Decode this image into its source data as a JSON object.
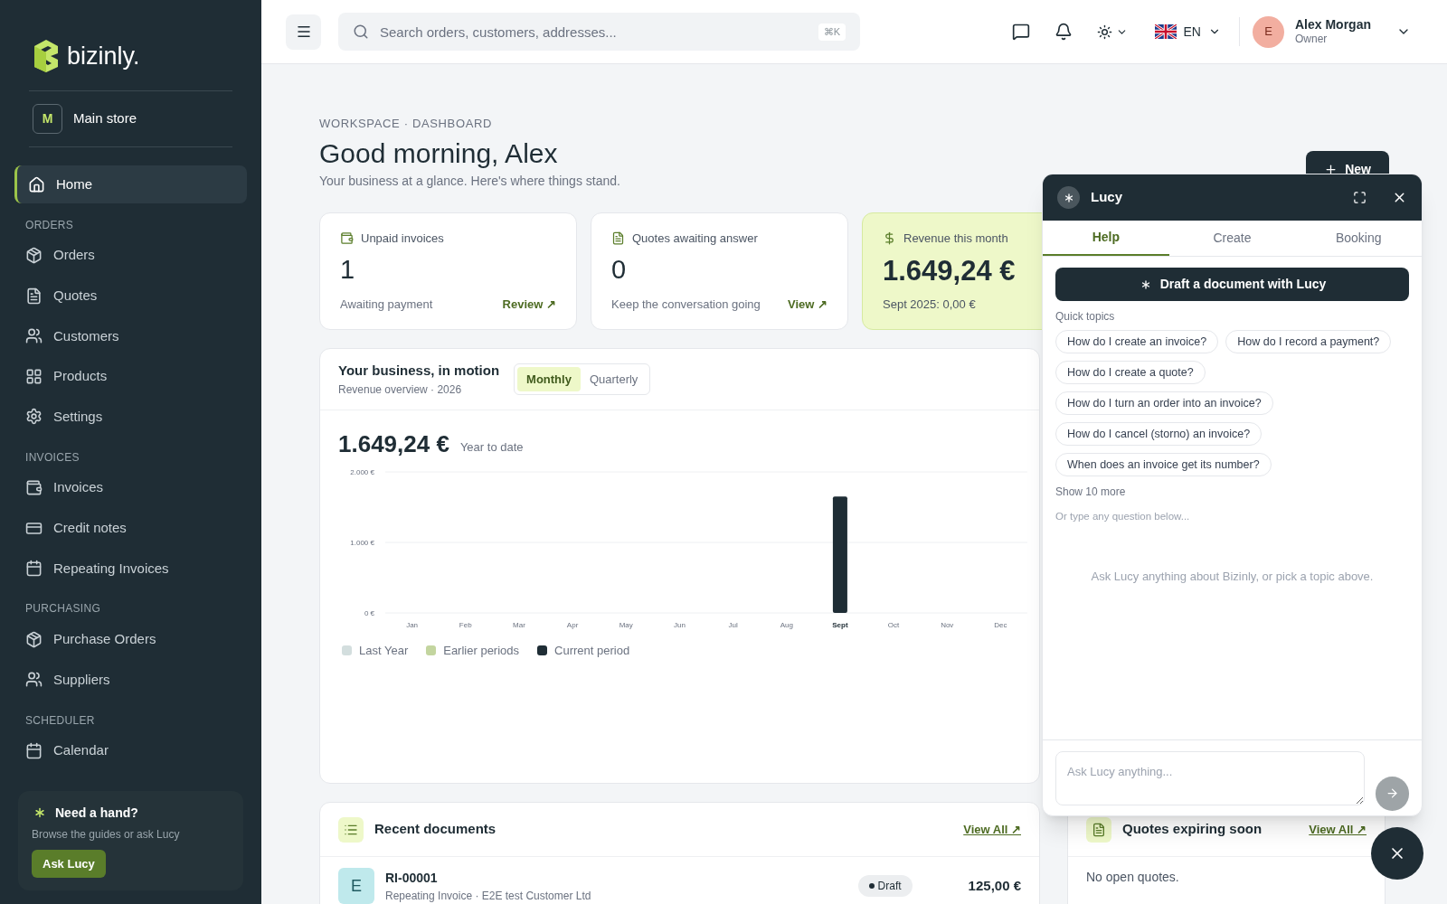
{
  "brand": {
    "name": "bizinly."
  },
  "store": {
    "initial": "M",
    "name": "Main store"
  },
  "sidebar": {
    "sections": [
      {
        "items": [
          {
            "label": "Home",
            "kind": "home",
            "selected": true
          }
        ]
      },
      {
        "title": "ORDERS",
        "items": [
          {
            "label": "Orders",
            "kind": "box",
            "selected": false
          },
          {
            "label": "Quotes",
            "kind": "file",
            "selected": false
          },
          {
            "label": "Customers",
            "kind": "users",
            "selected": false
          },
          {
            "label": "Products",
            "kind": "grid",
            "selected": false
          },
          {
            "label": "Settings",
            "kind": "gear",
            "selected": false
          }
        ]
      },
      {
        "title": "INVOICES",
        "items": [
          {
            "label": "Invoices",
            "kind": "wallet",
            "selected": false
          },
          {
            "label": "Credit notes",
            "kind": "card",
            "selected": false
          },
          {
            "label": "Repeating Invoices",
            "kind": "calendar",
            "selected": false
          }
        ]
      },
      {
        "title": "PURCHASING",
        "items": [
          {
            "label": "Purchase Orders",
            "kind": "box",
            "selected": false
          },
          {
            "label": "Suppliers",
            "kind": "users",
            "selected": false
          }
        ]
      },
      {
        "title": "SCHEDULER",
        "items": [
          {
            "label": "Calendar",
            "kind": "calendar",
            "selected": false
          }
        ]
      }
    ],
    "help": {
      "title": "Need a hand?",
      "text": "Browse the guides or ask Lucy",
      "button": "Ask Lucy"
    }
  },
  "topbar": {
    "search": {
      "placeholder": "Search orders, customers, addresses...",
      "shortcut": "⌘K"
    },
    "language": "EN",
    "user": {
      "initial": "E",
      "name": "Alex Morgan",
      "role": "Owner"
    }
  },
  "breadcrumb": "WORKSPACE · DASHBOARD",
  "greeting": "Good morning, Alex",
  "subtitle": "Your business at a glance. Here's where things stand.",
  "new_button": "New",
  "stats": [
    {
      "kind": "wallet",
      "label": "Unpaid invoices",
      "value": "1",
      "note": "Awaiting payment",
      "link": "Review ↗",
      "highlight": false
    },
    {
      "kind": "file",
      "label": "Quotes awaiting answer",
      "value": "0",
      "note": "Keep the conversation going",
      "link": "View ↗",
      "highlight": false
    },
    {
      "kind": "dollar",
      "label": "Revenue this month",
      "value": "1.649,24 €",
      "note": "Sept 2025: 0,00 €",
      "highlight": true
    }
  ],
  "overview": {
    "title": "Your business, in motion",
    "subtitle": "Revenue overview · 2026",
    "toggle": [
      {
        "label": "Monthly",
        "selected": true
      },
      {
        "label": "Quarterly",
        "selected": false
      }
    ],
    "total": "1.649,24 €",
    "total_label": "Year to date",
    "chart_data": {
      "type": "bar",
      "categories": [
        "Jan",
        "Feb",
        "Mar",
        "Apr",
        "May",
        "Jun",
        "Jul",
        "Aug",
        "Sept",
        "Oct",
        "Nov",
        "Dec"
      ],
      "series": [
        {
          "name": "Last Year",
          "color": "#d3dede",
          "values": [
            null,
            null,
            null,
            null,
            null,
            null,
            null,
            null,
            null,
            null,
            null,
            null
          ]
        },
        {
          "name": "Earlier periods",
          "color": "#c3d59f",
          "values": [
            null,
            null,
            null,
            null,
            null,
            null,
            null,
            null,
            null,
            null,
            null,
            null
          ]
        },
        {
          "name": "Current period",
          "color": "#1f2d35",
          "values": [
            null,
            null,
            null,
            null,
            null,
            null,
            null,
            null,
            1650,
            null,
            null,
            null
          ]
        }
      ],
      "ylim": [
        0,
        2000
      ],
      "yticks": [
        {
          "value": 0,
          "label": "0 €"
        },
        {
          "value": 1000,
          "label": "1.000 €"
        },
        {
          "value": 2000,
          "label": "2.000 €"
        }
      ]
    }
  },
  "recent": {
    "title": "Recent documents",
    "link": "View All ↗",
    "rows": [
      {
        "initial": "E",
        "number": "RI-00001",
        "detail": "Repeating Invoice · E2E test Customer Ltd",
        "status": "Draft",
        "amount": "125,00 €"
      }
    ]
  },
  "quotes_expiring": {
    "title": "Quotes expiring soon",
    "link": "View All ↗",
    "empty": "No open quotes."
  },
  "lucy": {
    "title": "Lucy",
    "tabs": [
      {
        "label": "Help",
        "selected": true
      },
      {
        "label": "Create",
        "selected": false
      },
      {
        "label": "Booking",
        "selected": false
      }
    ],
    "draft_button": "Draft a document with Lucy",
    "topics_label": "Quick topics",
    "topics": [
      "How do I create an invoice?",
      "How do I record a payment?",
      "How do I create a quote?",
      "How do I turn an order into an invoice?",
      "How do I cancel (storno) an invoice?",
      "When does an invoice get its number?"
    ],
    "show_more": "Show 10 more",
    "hint": "Or type any question below...",
    "empty": "Ask Lucy anything about Bizinly, or pick a topic above.",
    "input": {
      "placeholder": "Ask Lucy anything..."
    }
  }
}
